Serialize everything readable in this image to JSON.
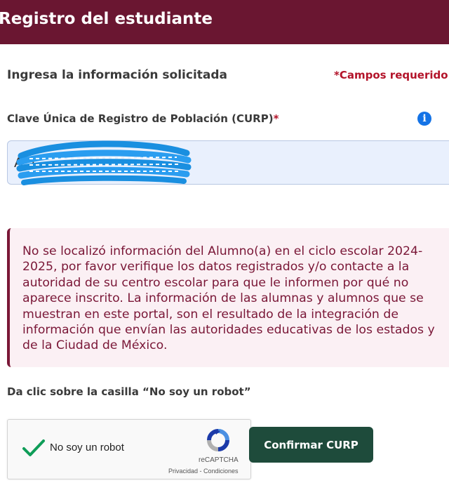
{
  "header": {
    "title": "Registro del estudiante"
  },
  "form": {
    "subtitle": "Ingresa la información solicitada",
    "required_note": "*Campos requerido",
    "curp_label": "Clave Única de Registro de Población (CURP)",
    "curp_required_mark": "*",
    "curp_value": "A                          1",
    "info_icon": "info-icon"
  },
  "alert": {
    "message": "No se localizó información del Alumno(a) en el ciclo escolar 2024-2025, por favor verifique los datos registrados y/o contacte a la autoridad de su centro escolar para que le informen por qué no aparece inscrito. La información de las alumnas y alumnos que se muestran en este portal, son el resultado de la integración de información que envían las autoridades educativas de los estados y de la Ciudad de México."
  },
  "captcha": {
    "instruction": "Da clic sobre la casilla “No soy un robot”",
    "label": "No soy un robot",
    "brand": "reCAPTCHA",
    "links": "Privacidad - Condiciones",
    "checked": true
  },
  "actions": {
    "confirm_label": "Confirmar CURP"
  },
  "colors": {
    "header": "#6a1631",
    "required": "#b3142a",
    "alert_text": "#7a1737",
    "alert_bg": "#fbf0f4",
    "button": "#1e4b3b",
    "input_bg": "#e9f0fd",
    "check": "#0f9d58"
  }
}
